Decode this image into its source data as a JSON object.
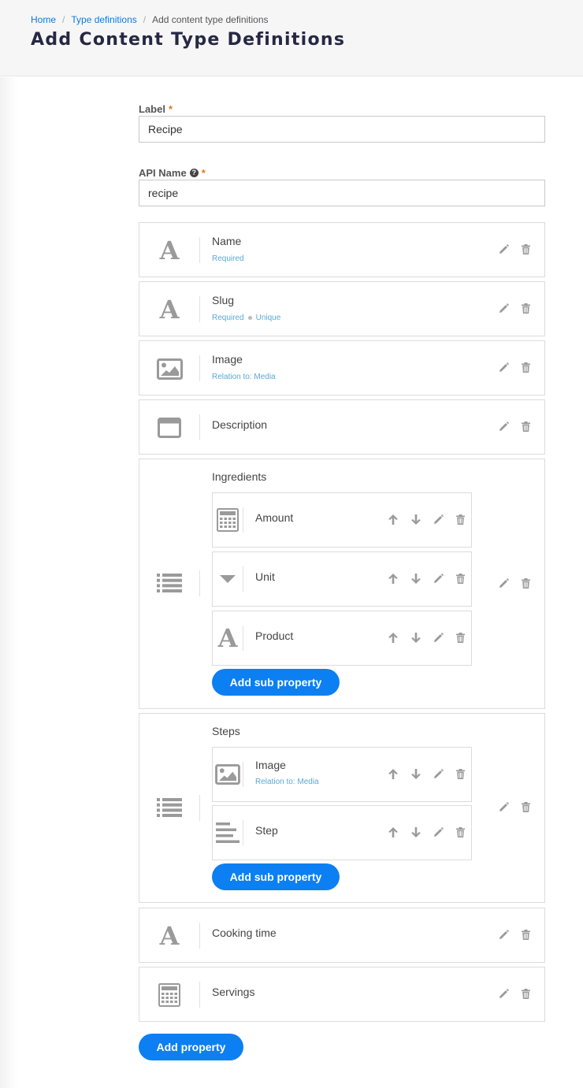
{
  "breadcrumb": {
    "home": "Home",
    "type_definitions": "Type definitions",
    "current": "Add content type definitions",
    "separator": "/"
  },
  "page_title": "Add Content Type Definitions",
  "form": {
    "label_field": {
      "label": "Label",
      "required_mark": "*",
      "value": "Recipe"
    },
    "api_name_field": {
      "label": "API Name",
      "help": "?",
      "required_mark": "*",
      "value": "recipe"
    }
  },
  "properties": [
    {
      "name": "Name",
      "icon": "text-a-icon",
      "meta": [
        "Required"
      ]
    },
    {
      "name": "Slug",
      "icon": "text-a-icon",
      "meta": [
        "Required",
        "Unique"
      ]
    },
    {
      "name": "Image",
      "icon": "image-icon",
      "meta": [
        "Relation to: Media"
      ]
    },
    {
      "name": "Description",
      "icon": "window-icon",
      "meta": []
    },
    {
      "name": "Ingredients",
      "icon": "list-icon",
      "sub_properties": [
        {
          "name": "Amount",
          "icon": "calculator-icon"
        },
        {
          "name": "Unit",
          "icon": "dropdown-caret-icon"
        },
        {
          "name": "Product",
          "icon": "text-a-icon"
        }
      ],
      "add_sub_label": "Add sub property"
    },
    {
      "name": "Steps",
      "icon": "list-icon",
      "sub_properties": [
        {
          "name": "Image",
          "icon": "image-icon",
          "meta": "Relation to: Media"
        },
        {
          "name": "Step",
          "icon": "paragraph-icon"
        }
      ],
      "add_sub_label": "Add sub property"
    },
    {
      "name": "Cooking time",
      "icon": "text-a-icon",
      "meta": []
    },
    {
      "name": "Servings",
      "icon": "calculator-icon",
      "meta": []
    }
  ],
  "add_property_label": "Add property",
  "colors": {
    "accent": "#0c7ff2",
    "link": "#0c7be0",
    "meta": "#5aa9d6",
    "icon": "#9a9a9a",
    "required": "#e07c1a",
    "title": "#262843"
  }
}
